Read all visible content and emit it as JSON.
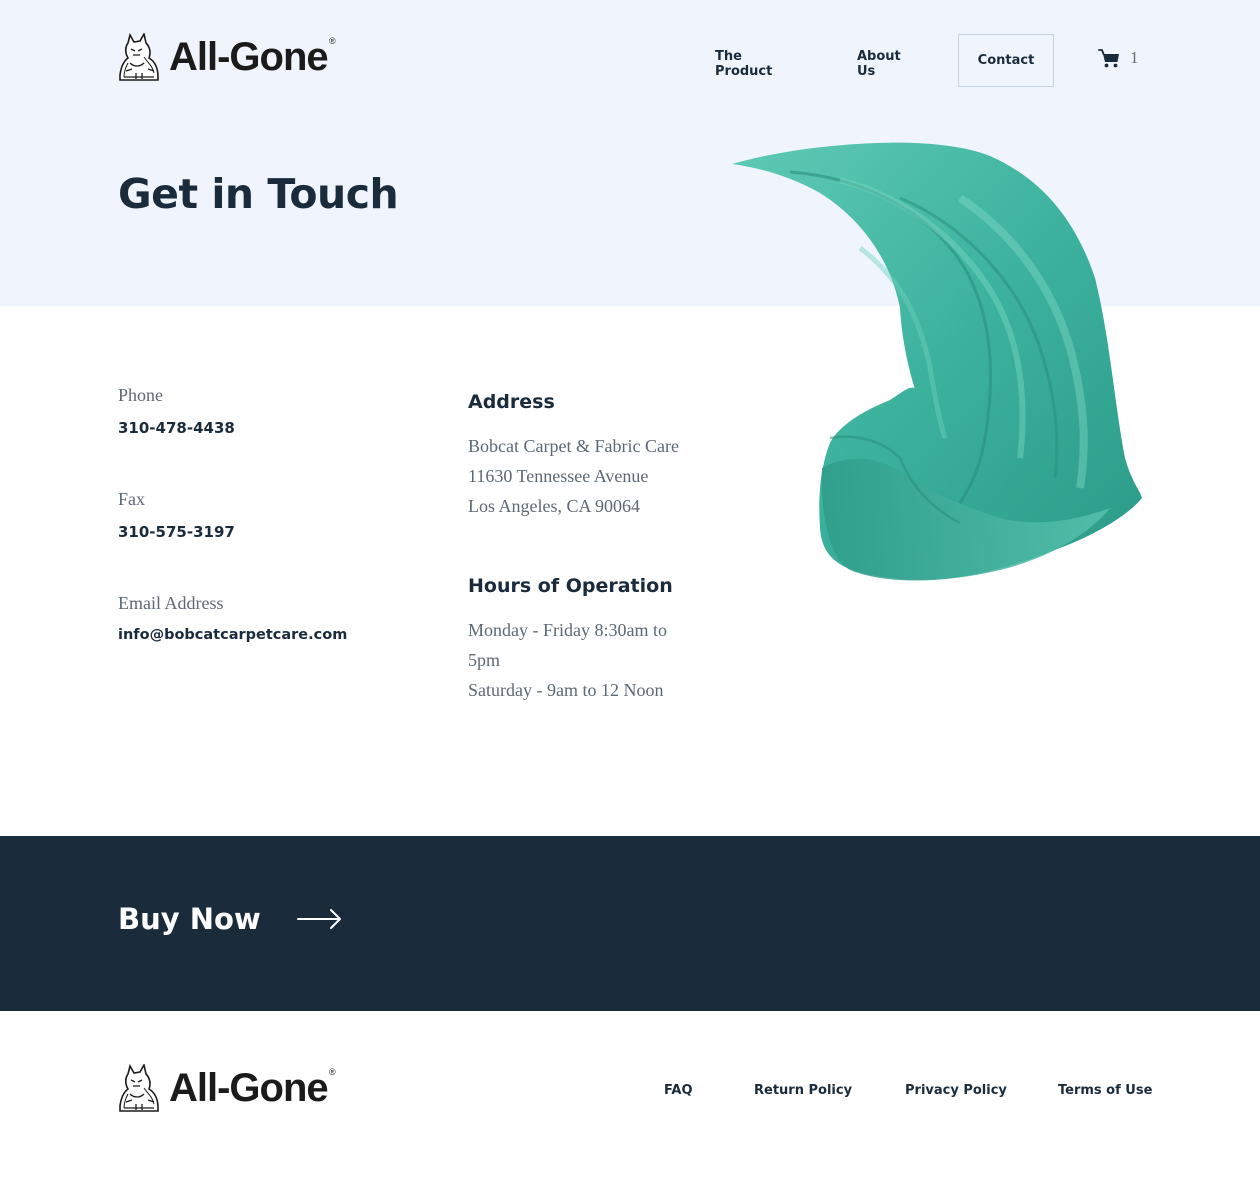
{
  "brand": {
    "name": "All-Gone",
    "registered_mark": "®",
    "logo_icon": "bobcat-icon"
  },
  "header": {
    "nav": [
      {
        "label": "The Product"
      },
      {
        "label": "About Us"
      },
      {
        "label": "Contact",
        "active": true
      }
    ],
    "cart": {
      "icon": "cart-icon",
      "count": "1"
    }
  },
  "hero": {
    "title": "Get in Touch",
    "image": "teal-fabric-image"
  },
  "contact": {
    "phone": {
      "label": "Phone",
      "value": "310-478-4438"
    },
    "fax": {
      "label": "Fax",
      "value": "310-575-3197"
    },
    "email": {
      "label": "Email Address",
      "value": "info@bobcatcarpetcare.com"
    }
  },
  "address": {
    "heading": "Address",
    "lines": [
      "Bobcat Carpet & Fabric Care",
      "11630 Tennessee Avenue",
      "Los Angeles, CA 90064"
    ]
  },
  "hours": {
    "heading": "Hours of Operation",
    "lines": [
      "Monday - Friday 8:30am to",
      "5pm",
      "Saturday - 9am to 12 Noon"
    ]
  },
  "cta": {
    "label": "Buy Now",
    "icon": "arrow-right-icon"
  },
  "footer": {
    "links": [
      {
        "label": "FAQ"
      },
      {
        "label": "Return Policy"
      },
      {
        "label": "Privacy Policy"
      },
      {
        "label": "Terms of Use"
      }
    ]
  },
  "colors": {
    "hero_background": "#f0f5fd",
    "navy": "#1a2b3c",
    "muted_text": "#5d6875",
    "fabric_teal": "#3fb3a0"
  }
}
